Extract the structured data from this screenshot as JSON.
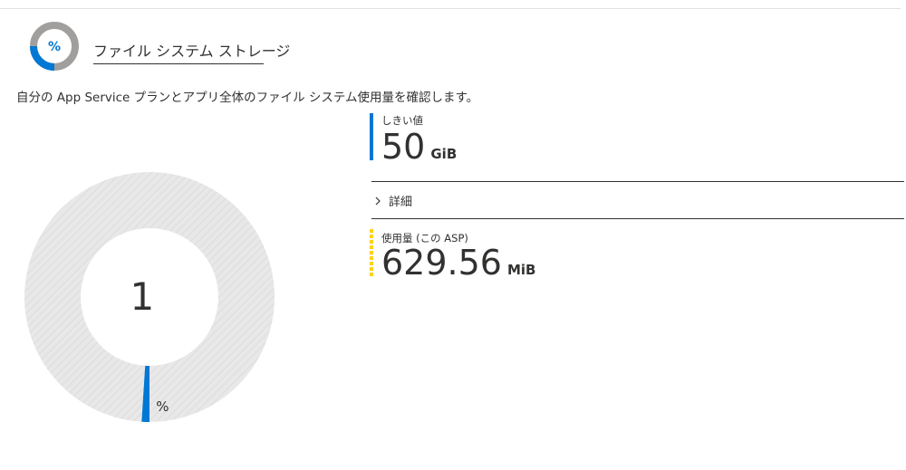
{
  "section": {
    "title": "ファイル システム ストレージ",
    "icon": "percent-gauge-icon",
    "description": "自分の App Service プランとアプリ全体のファイル システム使用量を確認します。"
  },
  "donut": {
    "value": "1",
    "unit": "%",
    "used_fraction": 0.01,
    "colors": {
      "track": "#e6e6e6",
      "used": "#0078d4"
    }
  },
  "threshold": {
    "label": "しきい値",
    "value": "50",
    "unit": "GiB",
    "color": "#0078d4"
  },
  "details": {
    "label": "詳細",
    "icon": "chevron-right-icon"
  },
  "usage": {
    "label": "使用量 (この ASP)",
    "value": "629.56",
    "unit": "MiB",
    "color": "#fcd116"
  }
}
